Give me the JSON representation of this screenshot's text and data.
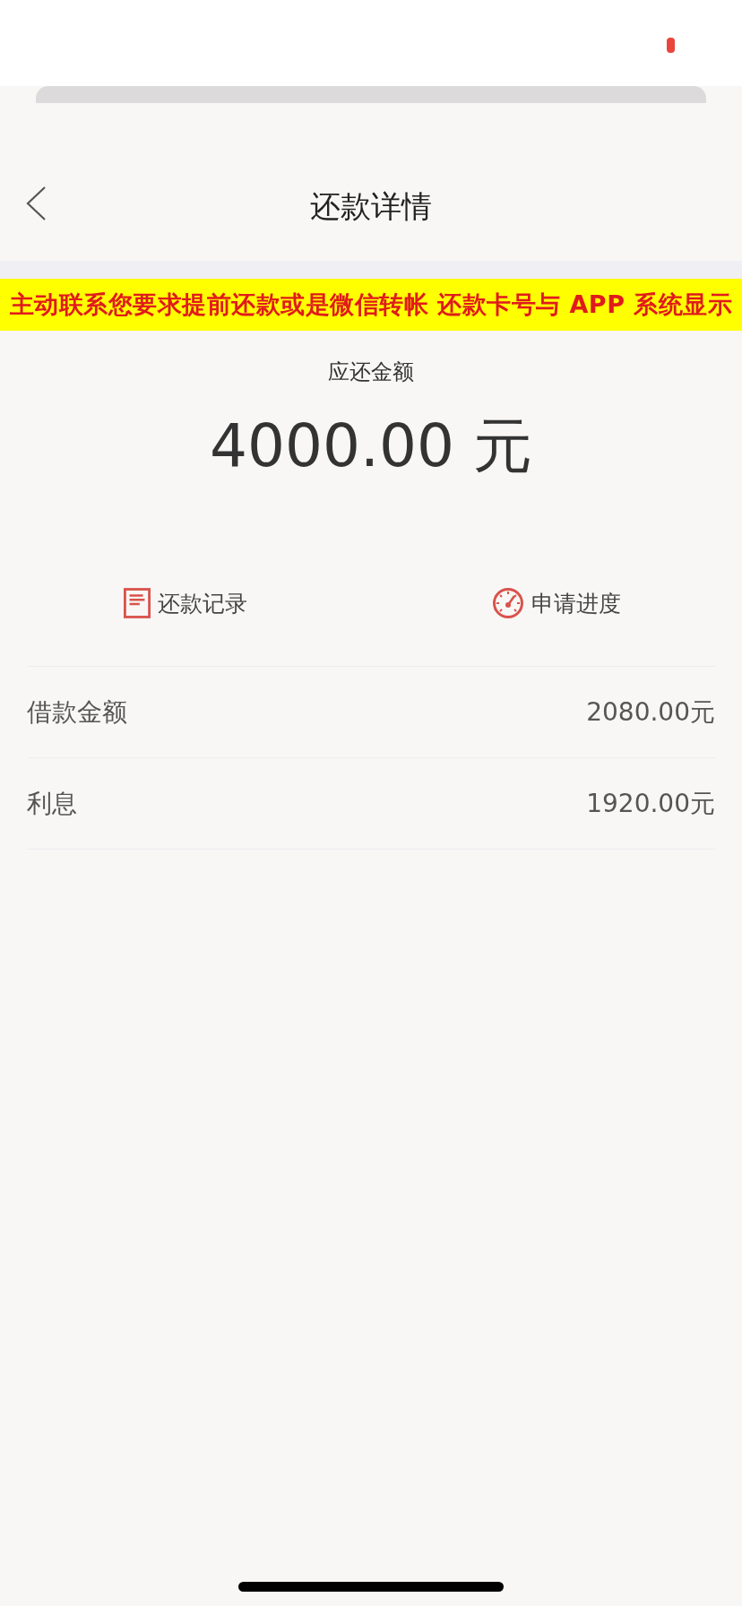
{
  "status_bar": {
    "recording": true
  },
  "nav": {
    "title": "还款详情"
  },
  "notice": {
    "text": "主动联系您要求提前还款或是微信转帐 还款卡号与 APP 系统显示"
  },
  "due": {
    "label": "应还金额",
    "amount": "4000.00",
    "unit": "元"
  },
  "actions": [
    {
      "kind": "record",
      "label": "还款记录"
    },
    {
      "kind": "progress",
      "label": "申请进度"
    }
  ],
  "details": [
    {
      "label": "借款金额",
      "value": "2080.00元"
    },
    {
      "label": "利息",
      "value": "1920.00元"
    }
  ]
}
